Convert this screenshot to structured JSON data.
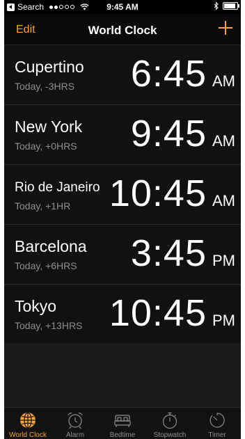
{
  "status_bar": {
    "back_label": "Search",
    "time": "9:45 AM"
  },
  "nav": {
    "edit_label": "Edit",
    "title": "World Clock"
  },
  "clocks": [
    {
      "city": "Cupertino",
      "offset": "Today, -3HRS",
      "time": "6:45",
      "ampm": "AM"
    },
    {
      "city": "New York",
      "offset": "Today, +0HRS",
      "time": "9:45",
      "ampm": "AM"
    },
    {
      "city": "Rio de Janeiro",
      "offset": "Today, +1HR",
      "time": "10:45",
      "ampm": "AM"
    },
    {
      "city": "Barcelona",
      "offset": "Today, +6HRS",
      "time": "3:45",
      "ampm": "PM"
    },
    {
      "city": "Tokyo",
      "offset": "Today, +13HRS",
      "time": "10:45",
      "ampm": "PM"
    }
  ],
  "tabs": [
    {
      "label": "World Clock",
      "icon": "globe-icon",
      "active": true
    },
    {
      "label": "Alarm",
      "icon": "alarm-clock-icon",
      "active": false
    },
    {
      "label": "Bedtime",
      "icon": "bed-icon",
      "active": false
    },
    {
      "label": "Stopwatch",
      "icon": "stopwatch-icon",
      "active": false
    },
    {
      "label": "Timer",
      "icon": "timer-icon",
      "active": false
    }
  ],
  "colors": {
    "accent": "#f7a43a",
    "background": "#000000",
    "secondary_text": "#8e8e93"
  }
}
